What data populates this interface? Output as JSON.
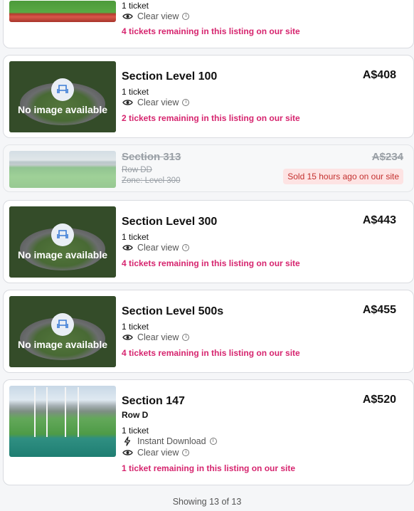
{
  "listings": [
    {
      "title": "",
      "detail": "1 ticket",
      "clear_view": "Clear view",
      "remaining": "4 tickets remaining in this listing on our site"
    },
    {
      "title": "Section Level 100",
      "price": "A$408",
      "detail": "1 ticket",
      "clear_view": "Clear view",
      "remaining": "2 tickets remaining in this listing on our site",
      "image_label": "No image available"
    },
    {
      "title": "Section 313",
      "price": "A$234",
      "row": "Row DD",
      "zone": "Zone: Level 300",
      "sold_badge": "Sold 15 hours ago on our site"
    },
    {
      "title": "Section Level 300",
      "price": "A$443",
      "detail": "1 ticket",
      "clear_view": "Clear view",
      "remaining": "4 tickets remaining in this listing on our site",
      "image_label": "No image available"
    },
    {
      "title": "Section Level 500s",
      "price": "A$455",
      "detail": "1 ticket",
      "clear_view": "Clear view",
      "remaining": "4 tickets remaining in this listing on our site",
      "image_label": "No image available"
    },
    {
      "title": "Section 147",
      "price": "A$520",
      "row": "Row D",
      "detail": "1 ticket",
      "instant_download": "Instant Download",
      "clear_view": "Clear view",
      "remaining": "1 ticket remaining in this listing on our site"
    }
  ],
  "footer": {
    "showing": "Showing 13 of 13"
  },
  "colors": {
    "remaining_text": "#d6246e",
    "sold_badge_bg": "#fde3e3",
    "sold_badge_text": "#c4312f",
    "seat_icon": "#3a7bd5"
  },
  "icons": [
    "eye-icon",
    "info-icon",
    "seat-icon",
    "lightning-icon"
  ]
}
